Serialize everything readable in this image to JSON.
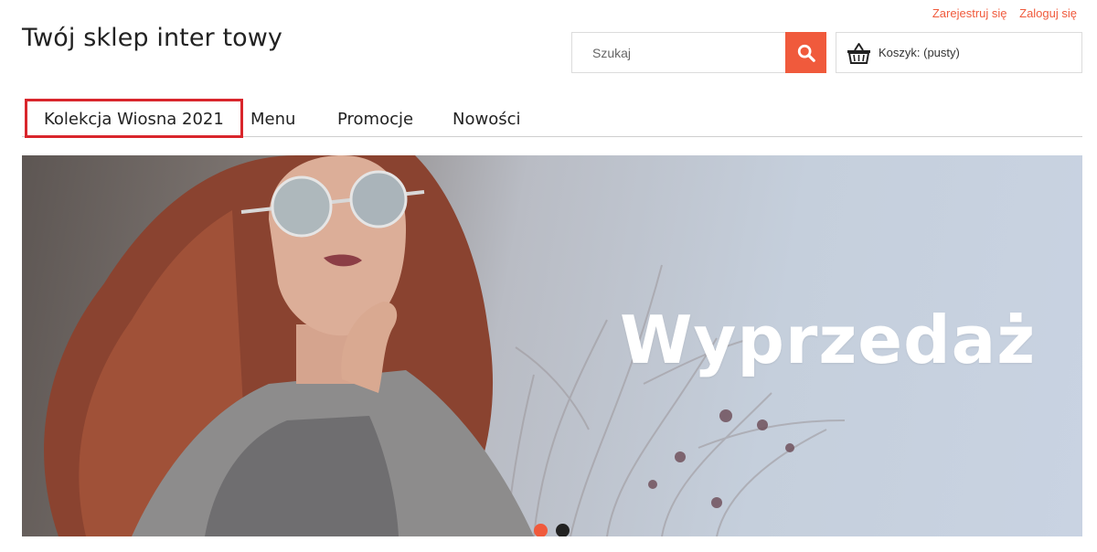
{
  "header": {
    "logo_text": "Twój sklep inter  towy",
    "register_label": "Zarejestruj się",
    "login_label": "Zaloguj się"
  },
  "search": {
    "placeholder": "Szukaj",
    "button_icon": "search-icon"
  },
  "cart": {
    "icon": "basket-icon",
    "label": "Koszyk: (pusty)"
  },
  "nav": {
    "items": [
      {
        "label": "Kolekcja Wiosna 2021",
        "active": true
      },
      {
        "label": "Menu"
      },
      {
        "label": "Promocje"
      },
      {
        "label": "Nowości"
      }
    ]
  },
  "hero": {
    "title": "Wyprzedaż",
    "slides_count": 2,
    "active_slide": 1
  },
  "colors": {
    "accent": "#f05a3c",
    "active_outline": "#d9262c",
    "inactive_dot": "#222222"
  }
}
